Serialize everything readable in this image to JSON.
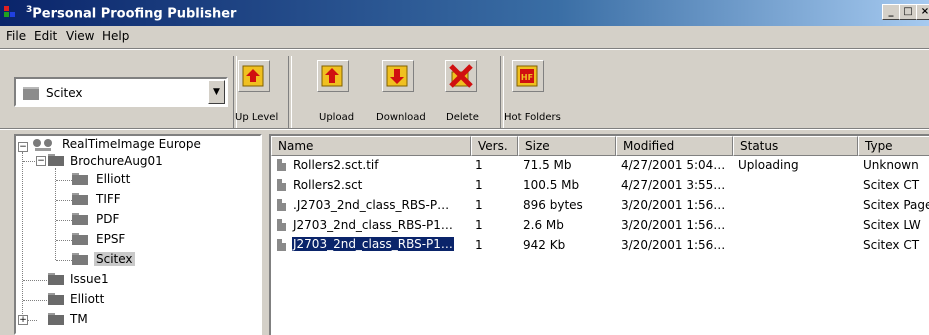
{
  "window": {
    "title": "Personal Proofing Publisher",
    "app_icon_superscript": "3",
    "controls": [
      "_",
      "□",
      "×"
    ]
  },
  "menu": [
    "File",
    "Edit",
    "View",
    "Help"
  ],
  "toolbar": {
    "location_value": "Scitex",
    "buttons": [
      {
        "label": "Up Level",
        "icon": "up-level-icon"
      },
      {
        "label": "Upload",
        "icon": "upload-icon"
      },
      {
        "label": "Download",
        "icon": "download-icon"
      },
      {
        "label": "Delete",
        "icon": "delete-icon"
      },
      {
        "label": "Hot Folders",
        "icon": "hot-folders-icon"
      }
    ]
  },
  "tree": {
    "root": "RealTimeImage Europe",
    "items": [
      {
        "label": "BrochureAug01"
      },
      {
        "label": "Elliott"
      },
      {
        "label": "TIFF"
      },
      {
        "label": "PDF"
      },
      {
        "label": "EPSF"
      },
      {
        "label": "Scitex"
      },
      {
        "label": "Issue1"
      },
      {
        "label": "Elliott"
      },
      {
        "label": "TM"
      }
    ],
    "selected": "Scitex"
  },
  "list": {
    "columns": [
      "Name",
      "Vers.",
      "Size",
      "Modified",
      "Status",
      "Type"
    ],
    "rows": [
      {
        "name": "Rollers2.sct.tif",
        "vers": "1",
        "size": "71.5 Mb",
        "modified": "4/27/2001 5:04…",
        "status": "Uploading",
        "type": "Unknown"
      },
      {
        "name": "Rollers2.sct",
        "vers": "1",
        "size": "100.5 Mb",
        "modified": "4/27/2001 3:55…",
        "status": "",
        "type": "Scitex CT"
      },
      {
        "name": ".J2703_2nd_class_RBS-P…",
        "vers": "1",
        "size": "896 bytes",
        "modified": "3/20/2001 1:56…",
        "status": "",
        "type": "Scitex Page"
      },
      {
        "name": "J2703_2nd_class_RBS-P1…",
        "vers": "1",
        "size": "2.6 Mb",
        "modified": "3/20/2001 1:56…",
        "status": "",
        "type": "Scitex LW"
      },
      {
        "name": "J2703_2nd_class_RBS-P1…",
        "vers": "1",
        "size": "942 Kb",
        "modified": "3/20/2001 1:56…",
        "status": "",
        "type": "Scitex CT"
      }
    ],
    "selected_row": 4
  },
  "colors": {
    "titlebar_start": "#0a246a",
    "titlebar_end": "#a6caf0",
    "chrome": "#d4d0c8",
    "selection": "#0a246a",
    "icon_red": "#d01010",
    "icon_yellow": "#f0c020"
  }
}
